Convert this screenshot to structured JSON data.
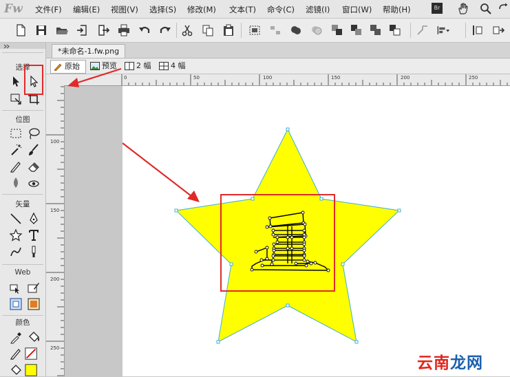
{
  "app": {
    "logo": "Fw"
  },
  "menu": {
    "items": [
      "文件(F)",
      "编辑(E)",
      "视图(V)",
      "选择(S)",
      "修改(M)",
      "文本(T)",
      "命令(C)",
      "滤镜(I)",
      "窗口(W)",
      "帮助(H)"
    ],
    "bridge_badge": "Br"
  },
  "tools": {
    "sections": {
      "select": "选择",
      "bitmap": "位图",
      "vector": "矢量",
      "web": "Web",
      "colors": "颜色"
    },
    "fill_color": "#ffff00",
    "stroke_color": "#e00000"
  },
  "document": {
    "tab_title": "*未命名-1.fw.png",
    "views": {
      "original": "原始",
      "preview": "预览",
      "two_up": "2 幅",
      "four_up": "4 幅"
    }
  },
  "rulers": {
    "top": [
      "0",
      "50",
      "100",
      "150",
      "200",
      "250"
    ],
    "left": [
      "100",
      "150",
      "200",
      "250"
    ]
  },
  "artwork": {
    "shape": "star",
    "fill": "#ffff00",
    "path_color": "#3fb0d6",
    "glyph": "皇"
  },
  "annotations": {
    "highlight_color": "#e02a2a"
  },
  "watermark": {
    "part1": "云南",
    "part2": "龙网"
  }
}
